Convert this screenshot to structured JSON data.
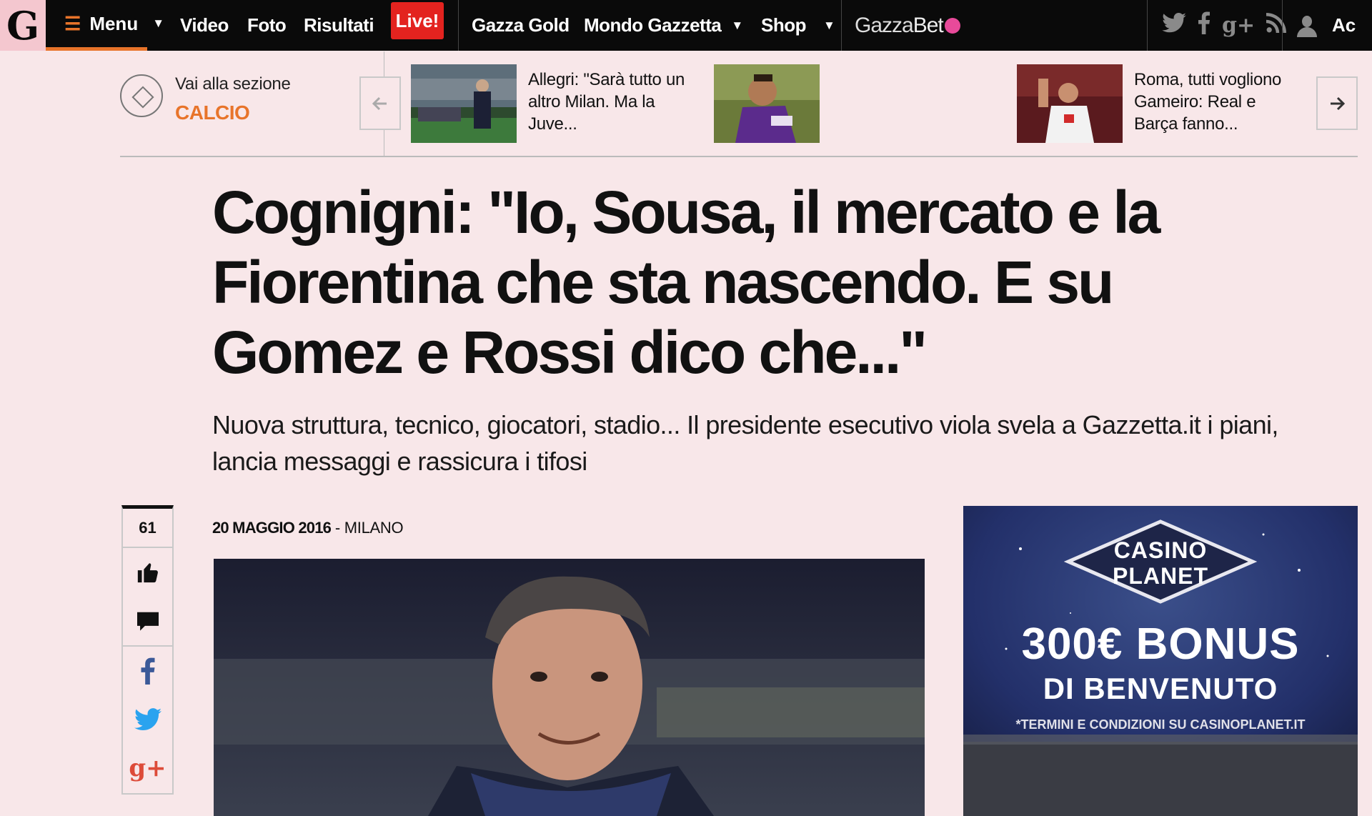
{
  "topbar": {
    "logo_letter": "G",
    "menu_label": "Menu",
    "nav": [
      "Video",
      "Foto",
      "Risultati"
    ],
    "live_label": "Live!",
    "gazza_gold": "Gazza Gold",
    "mondo_gazzetta": "Mondo Gazzetta",
    "shop": "Shop",
    "gazzabet_prefix": "Gazza",
    "gazzabet_suffix": "Bet",
    "account_label": "Ac",
    "social_icons": [
      "twitter-icon",
      "facebook-icon",
      "google-plus-icon",
      "rss-icon"
    ],
    "accent_color": "#e8742a",
    "live_color": "#e3231f"
  },
  "section": {
    "label": "Vai alla sezione",
    "name": "CALCIO"
  },
  "carousel": {
    "items": [
      {
        "title": "Allegri: \"Sarà tutto un altro Milan. Ma la Juve..."
      },
      {
        "title": "Roma, tutti vogliono Gameiro: Real e Barça fanno..."
      }
    ]
  },
  "article": {
    "headline": "Cognigni: \"Io, Sousa, il mercato e la Fiorentina che sta nascendo. E su Gomez e Rossi dico che...\"",
    "subheadline": "Nuova struttura, tecnico, giocatori, stadio... Il presidente esecutivo viola svela a Gazzetta.it i piani, lancia messaggi e rassicura i tifosi",
    "date": "20 MAGGIO 2016",
    "location_sep": " - ",
    "location": "MILANO"
  },
  "share": {
    "count": "61"
  },
  "ad": {
    "brand_line1": "CASINO",
    "brand_line2": "PLANET",
    "bonus": "300€ BONUS",
    "welcome": "DI BENVENUTO",
    "terms": "*TERMINI E CONDIZIONI SU CASINOPLANET.IT"
  }
}
